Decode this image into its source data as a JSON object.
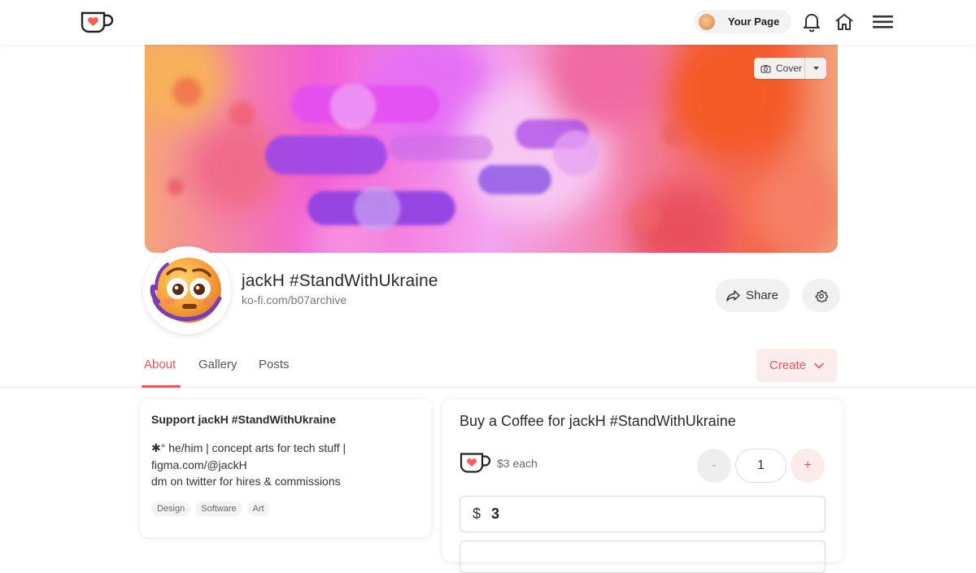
{
  "header": {
    "your_page_label": "Your Page",
    "icons": [
      "ko-fi-logo-icon",
      "avatar",
      "bell-icon",
      "home-icon",
      "menu-icon"
    ]
  },
  "cover": {
    "button_label": "Cover"
  },
  "profile": {
    "name": "jackH #StandWithUkraine",
    "url": "ko-fi.com/b07archive",
    "share_label": "Share"
  },
  "tabs": {
    "items": [
      {
        "label": "About",
        "active": true
      },
      {
        "label": "Gallery",
        "active": false
      },
      {
        "label": "Posts",
        "active": false
      }
    ],
    "create_label": "Create"
  },
  "about": {
    "title": "Support jackH #StandWithUkraine",
    "bio_line1": "✱° he/him | concept arts for tech stuff |",
    "bio_line2": "figma.com/@jackH",
    "bio_line3": "dm on twitter for hires & commissions",
    "tags": [
      "Design",
      "Software",
      "Art"
    ]
  },
  "coffee": {
    "title": "Buy a Coffee for jackH #StandWithUkraine",
    "price_label": "$3 each",
    "minus_label": "-",
    "quantity": "1",
    "plus_label": "+",
    "currency": "$",
    "amount": "3"
  },
  "colors": {
    "accent": "#e9575c",
    "accent_soft": "#fdecec"
  }
}
